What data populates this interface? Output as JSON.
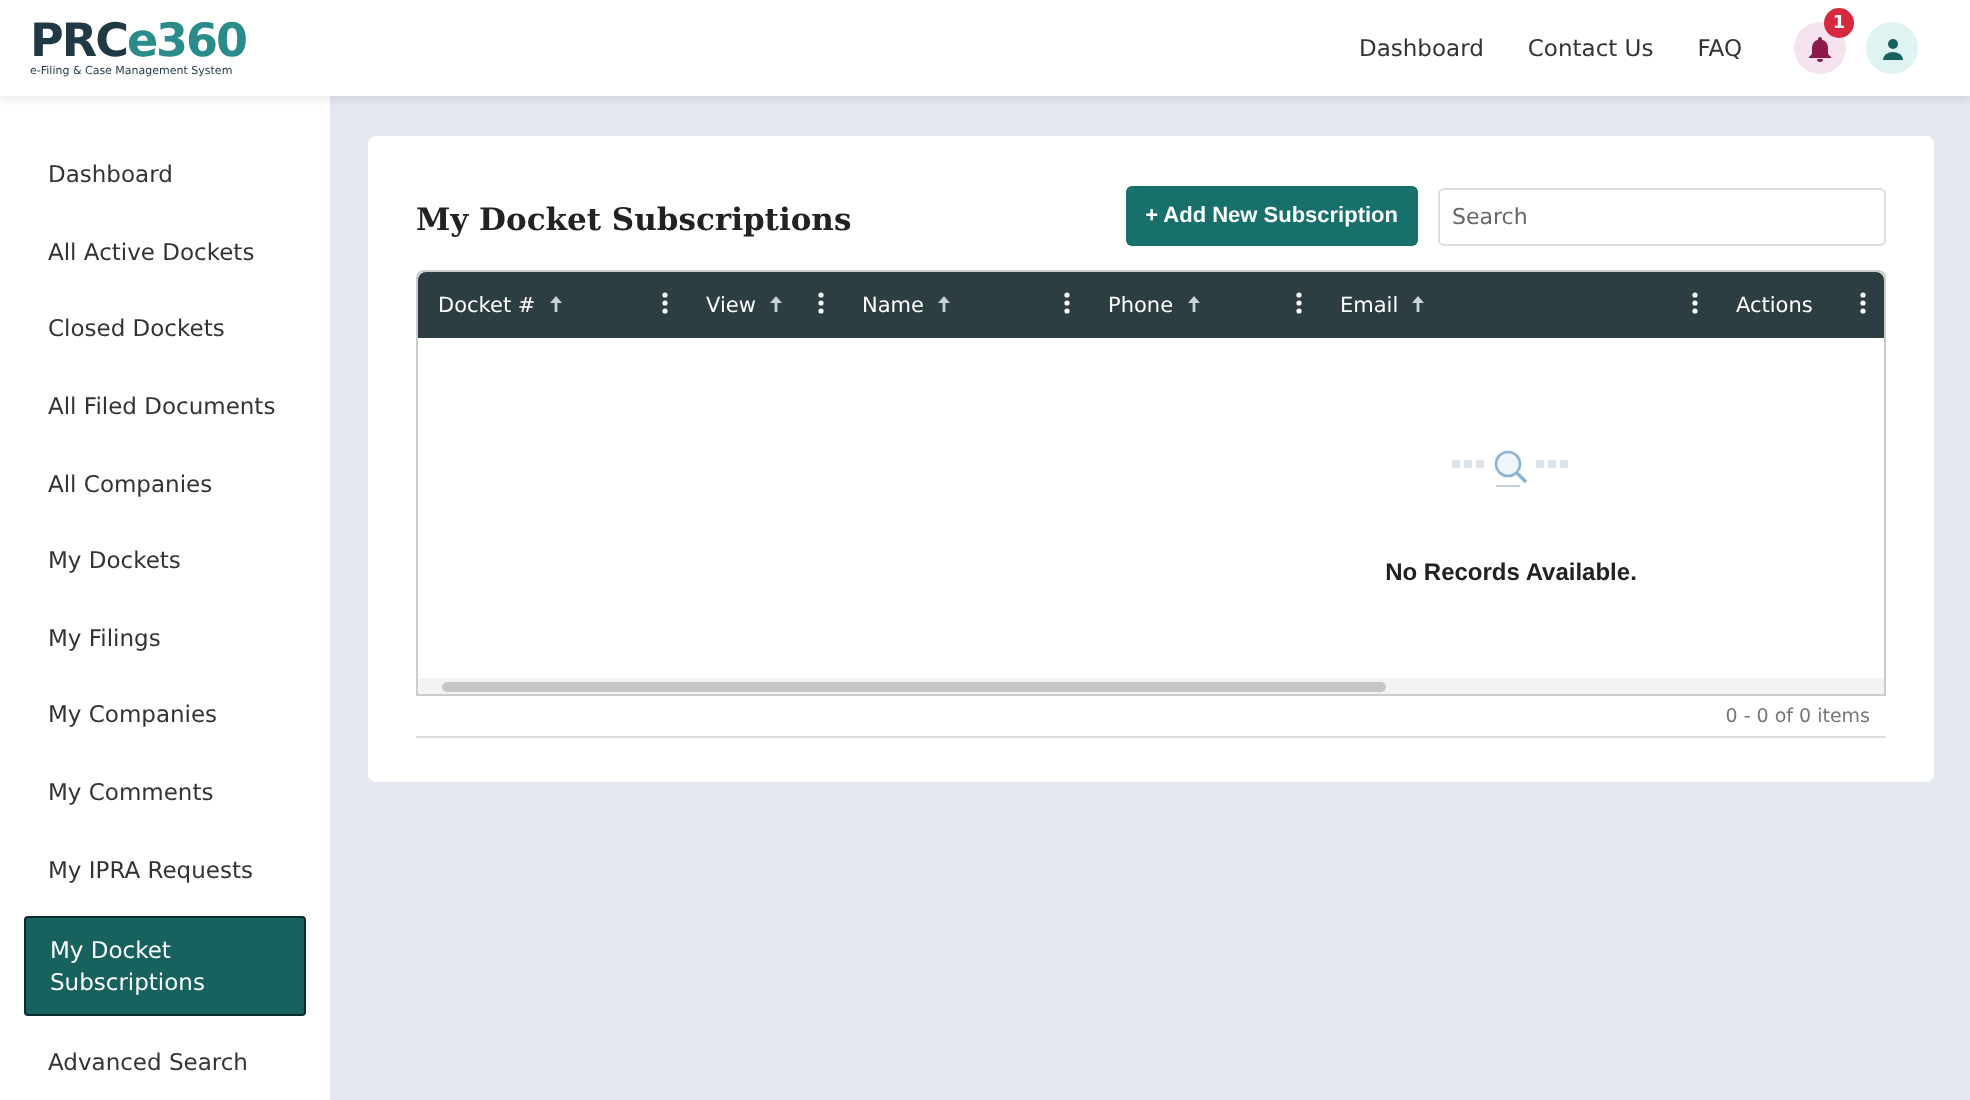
{
  "header": {
    "logo_main": "PRC",
    "logo_accent": "e360",
    "logo_subtitle": "e-Filing & Case Management System",
    "nav": [
      "Dashboard",
      "Contact Us",
      "FAQ"
    ],
    "notification_count": "1"
  },
  "sidebar": {
    "items": [
      {
        "label": "Dashboard",
        "selected": false
      },
      {
        "label": "All Active Dockets",
        "selected": false
      },
      {
        "label": "Closed Dockets",
        "selected": false
      },
      {
        "label": "All Filed Documents",
        "selected": false
      },
      {
        "label": "All Companies",
        "selected": false
      },
      {
        "label": "My Dockets",
        "selected": false
      },
      {
        "label": "My Filings",
        "selected": false
      },
      {
        "label": "My Companies",
        "selected": false
      },
      {
        "label": "My Comments",
        "selected": false
      },
      {
        "label": "My IPRA Requests",
        "selected": false
      },
      {
        "label": "My Docket Subscriptions",
        "selected": true
      },
      {
        "label": "Advanced Search",
        "selected": false
      }
    ]
  },
  "card": {
    "title": "My Docket Subscriptions",
    "add_button": "+ Add New Subscription",
    "search": {
      "placeholder": "Search"
    },
    "table": {
      "columns": [
        {
          "label": "Docket #",
          "sortable": true
        },
        {
          "label": "View",
          "sortable": true
        },
        {
          "label": "Name",
          "sortable": true
        },
        {
          "label": "Phone",
          "sortable": true
        },
        {
          "label": "Email",
          "sortable": true
        },
        {
          "label": "Actions",
          "sortable": false
        }
      ],
      "empty_message": "No Records Available.",
      "pager": "0 - 0 of 0 items"
    }
  }
}
